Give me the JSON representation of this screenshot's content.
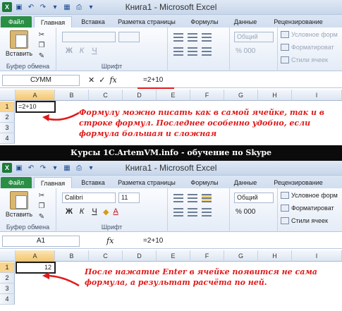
{
  "window": {
    "title": "Книга1 - Microsoft Excel"
  },
  "tabs": [
    "Файл",
    "Главная",
    "Вставка",
    "Разметка страницы",
    "Формулы",
    "Данные",
    "Рецензирование"
  ],
  "ribbon": {
    "clipboard_label": "Буфер обмена",
    "paste_label": "Вставить",
    "font_label": "Шрифт",
    "number_format": "Общий",
    "styles": {
      "conditional": "Условное форм",
      "format_as_table": "Форматироват",
      "cell_styles": "Стили ячеек"
    }
  },
  "top": {
    "name_box": "СУММ",
    "formula": "=2+10",
    "cell_a1": "=2+10",
    "font_name": "",
    "font_size": ""
  },
  "bottom": {
    "name_box": "A1",
    "formula": "=2+10",
    "cell_a1": "12",
    "font_name": "Calibri",
    "font_size": "11"
  },
  "grid": {
    "columns": [
      "A",
      "B",
      "C",
      "D",
      "E",
      "F",
      "G",
      "H",
      "I"
    ],
    "rows": [
      "1",
      "2",
      "3",
      "4"
    ]
  },
  "annotations": {
    "top_note": "Формулу можно писать как в самой ячейке, так и в строке формул. Последнее особенно удобно, если формула большая и сложная",
    "bottom_note": "После нажатие Enter в ячейке появится не сама формула, а результат расчёта по ней."
  },
  "banner": "Курсы 1C.ArtemVM.info - обучение по Skype",
  "colors": {
    "accent_red": "#e01a1a",
    "file_tab": "#2a8f45",
    "ribbon": "#dbe6f4"
  }
}
